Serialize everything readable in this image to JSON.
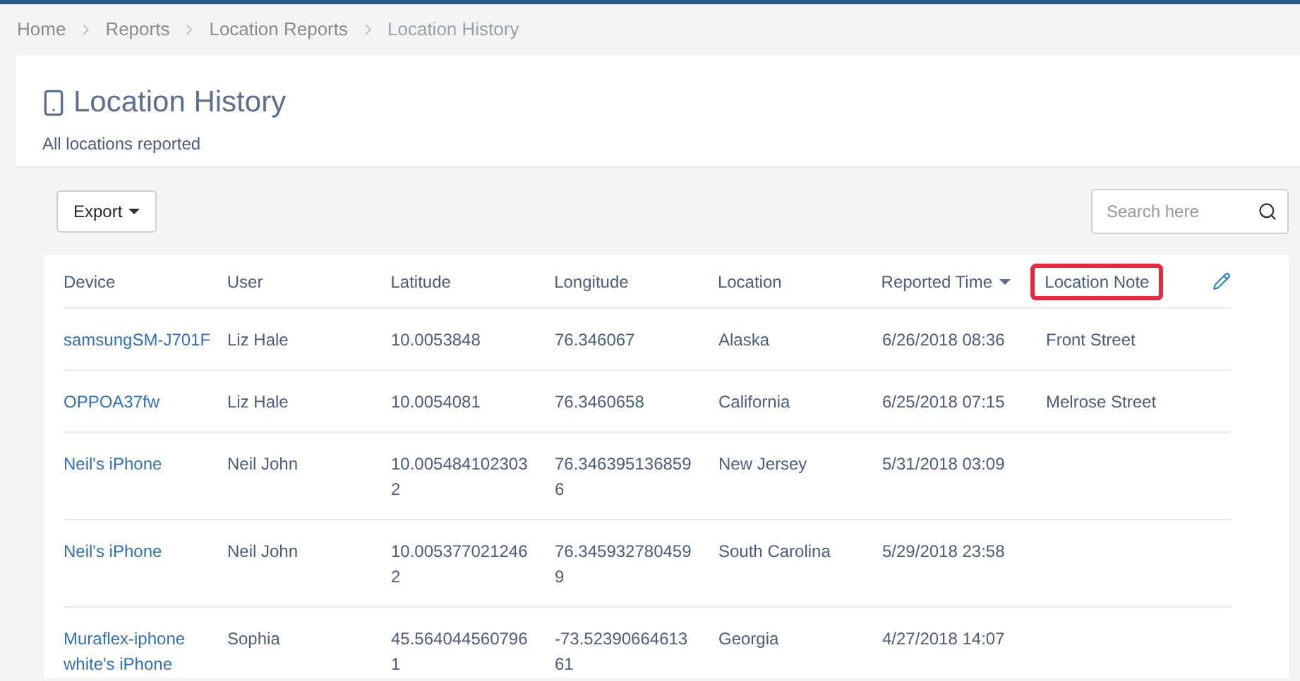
{
  "breadcrumb": [
    {
      "label": "Home",
      "current": false
    },
    {
      "label": "Reports",
      "current": false
    },
    {
      "label": "Location Reports",
      "current": false
    },
    {
      "label": "Location History",
      "current": true
    }
  ],
  "header": {
    "title": "Location History",
    "subtitle": "All locations reported"
  },
  "toolbar": {
    "export_label": "Export",
    "search": {
      "placeholder": "Search here"
    }
  },
  "table": {
    "columns": [
      {
        "label": "Device",
        "sorted": false,
        "highlighted": false
      },
      {
        "label": "User",
        "sorted": false,
        "highlighted": false
      },
      {
        "label": "Latitude",
        "sorted": false,
        "highlighted": false
      },
      {
        "label": "Longitude",
        "sorted": false,
        "highlighted": false
      },
      {
        "label": "Location",
        "sorted": false,
        "highlighted": false
      },
      {
        "label": "Reported Time",
        "sorted": true,
        "highlighted": false
      },
      {
        "label": "Location Note",
        "sorted": false,
        "highlighted": true
      }
    ],
    "rows": [
      [
        "samsungSM-J701F",
        "Liz Hale",
        "10.0053848",
        "76.346067",
        "Alaska",
        "6/26/2018 08:36",
        "Front Street"
      ],
      [
        "OPPOA37fw",
        "Liz Hale",
        "10.0054081",
        "76.3460658",
        "California",
        "6/25/2018 07:15",
        "Melrose Street"
      ],
      [
        "Neil's iPhone",
        "Neil John",
        "10.0054841023032",
        "76.3463951368596",
        "New Jersey",
        "5/31/2018 03:09",
        ""
      ],
      [
        "Neil's iPhone",
        "Neil John",
        "10.0053770212462",
        "76.3459327804599",
        "South Carolina",
        "5/29/2018 23:58",
        ""
      ],
      [
        "Muraflex-iphone white's iPhone",
        "Sophia",
        "45.5640445607961",
        "-73.5239066461361",
        "Georgia",
        "4/27/2018 14:07",
        ""
      ]
    ]
  }
}
